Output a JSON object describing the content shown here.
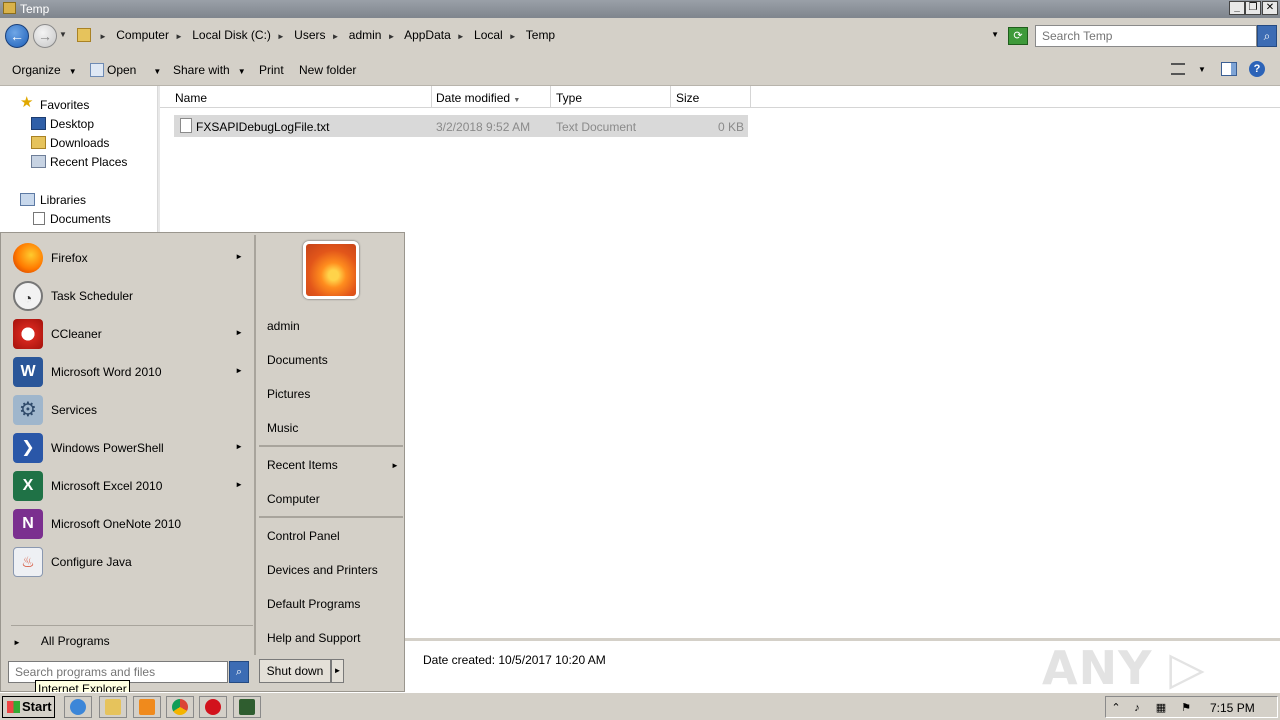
{
  "window": {
    "title": "Temp",
    "buttons": {
      "minimize": "_",
      "restore": "❐",
      "close": "✕"
    }
  },
  "address": {
    "breadcrumbs": [
      "Computer",
      "Local Disk (C:)",
      "Users",
      "admin",
      "AppData",
      "Local",
      "Temp"
    ],
    "search_placeholder": "Search Temp"
  },
  "toolbar": {
    "organize": "Organize",
    "open": "Open",
    "share_with": "Share with",
    "print": "Print",
    "new_folder": "New folder"
  },
  "navpane": {
    "favorites": "Favorites",
    "desktop": "Desktop",
    "downloads": "Downloads",
    "recent_places": "Recent Places",
    "libraries": "Libraries",
    "documents": "Documents"
  },
  "columns": {
    "name": "Name",
    "date_modified": "Date modified",
    "type": "Type",
    "size": "Size"
  },
  "files": [
    {
      "name": "FXSAPIDebugLogFile.txt",
      "date": "3/2/2018 9:52 AM",
      "type": "Text Document",
      "size": "0 KB"
    }
  ],
  "details": {
    "date_created": "Date created:  10/5/2017 10:20 AM",
    "watermark": "ANY ▷ RUN"
  },
  "start_menu": {
    "programs": [
      {
        "label": "Firefox",
        "icon": "firefox-icon",
        "arrow": true
      },
      {
        "label": "Task Scheduler",
        "icon": "clock-icon",
        "arrow": false
      },
      {
        "label": "CCleaner",
        "icon": "ccleaner-icon",
        "arrow": true
      },
      {
        "label": "Microsoft Word 2010",
        "icon": "word-icon",
        "arrow": true
      },
      {
        "label": "Services",
        "icon": "gear-icon",
        "arrow": false
      },
      {
        "label": "Windows PowerShell",
        "icon": "powershell-icon",
        "arrow": true
      },
      {
        "label": "Microsoft Excel 2010",
        "icon": "excel-icon",
        "arrow": true
      },
      {
        "label": "Microsoft OneNote 2010",
        "icon": "onenote-icon",
        "arrow": false
      },
      {
        "label": "Configure Java",
        "icon": "java-icon",
        "arrow": false
      }
    ],
    "all_programs": "All Programs",
    "right_links": {
      "admin": "admin",
      "documents": "Documents",
      "pictures": "Pictures",
      "music": "Music",
      "recent_items": "Recent Items",
      "computer": "Computer",
      "control_panel": "Control Panel",
      "devices_printers": "Devices and Printers",
      "default_programs": "Default Programs",
      "help_support": "Help and Support"
    },
    "search_placeholder": "Search programs and files",
    "shutdown": "Shut down",
    "tooltip": "Internet Explorer"
  },
  "taskbar": {
    "start": "Start",
    "clock": "7:15 PM"
  },
  "colors": {
    "accent": "#3c6cb4",
    "selection": "#d9d9d9",
    "chrome": "#d4d0c8"
  }
}
